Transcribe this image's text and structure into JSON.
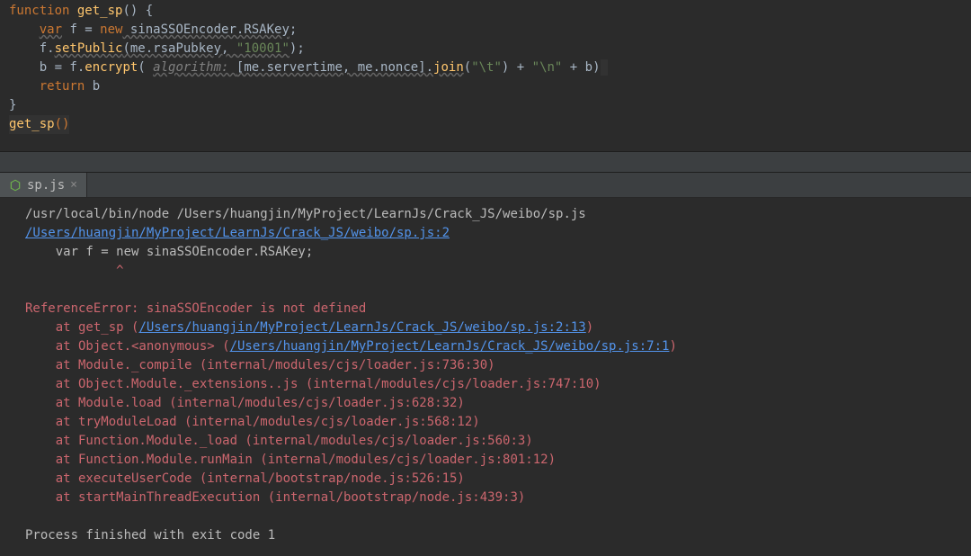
{
  "editor": {
    "l1_kw_function": "function",
    "l1_fn": " get_sp",
    "l1_paren": "() {",
    "l2_indent": "    ",
    "l2_var": "var",
    "l2_rest": " f = ",
    "l2_new": "new",
    "l2_sina": " sinaSSOEncoder.RSAKey",
    "l2_semi": ";",
    "l3_indent": "    f.",
    "l3_fn": "setPublic",
    "l3_args1": "(me.rsaPubkey, ",
    "l3_str": "\"10001\"",
    "l3_args2": ");",
    "l4_indent": "    b = f.",
    "l4_fn": "encrypt",
    "l4_open": "( ",
    "l4_algo": "algorithm: ",
    "l4_arr": "[me.servertime, me.nonce].",
    "l4_join": "join",
    "l4_joinarg": "(",
    "l4_t": "\"\\t\"",
    "l4_mid": ") + ",
    "l4_n": "\"\\n\"",
    "l4_plus": " + b)",
    "l5_indent": "    ",
    "l5_return": "return",
    "l5_b": " b",
    "l6_close": "}",
    "l7_call": "get_sp",
    "l7_paren": "()"
  },
  "tab": {
    "filename": "sp.js",
    "close": "×"
  },
  "console": {
    "run_cmd": "/usr/local/bin/node /Users/huangjin/MyProject/LearnJs/Crack_JS/weibo/sp.js",
    "link1": "/Users/huangjin/MyProject/LearnJs/Crack_JS/weibo/sp.js:2",
    "echo_line": "    var f = new sinaSSOEncoder.RSAKey;",
    "caret_line": "            ^",
    "err_title": "ReferenceError: sinaSSOEncoder is not defined",
    "at1_pre": "    at get_sp (",
    "at1_link": "/Users/huangjin/MyProject/LearnJs/Crack_JS/weibo/sp.js:2:13",
    "at1_post": ")",
    "at2_pre": "    at Object.<anonymous> (",
    "at2_link": "/Users/huangjin/MyProject/LearnJs/Crack_JS/weibo/sp.js:7:1",
    "at2_post": ")",
    "at3": "    at Module._compile (internal/modules/cjs/loader.js:736:30)",
    "at4": "    at Object.Module._extensions..js (internal/modules/cjs/loader.js:747:10)",
    "at5": "    at Module.load (internal/modules/cjs/loader.js:628:32)",
    "at6": "    at tryModuleLoad (internal/modules/cjs/loader.js:568:12)",
    "at7": "    at Function.Module._load (internal/modules/cjs/loader.js:560:3)",
    "at8": "    at Function.Module.runMain (internal/modules/cjs/loader.js:801:12)",
    "at9": "    at executeUserCode (internal/bootstrap/node.js:526:15)",
    "at10": "    at startMainThreadExecution (internal/bootstrap/node.js:439:3)",
    "exit": "Process finished with exit code 1"
  }
}
